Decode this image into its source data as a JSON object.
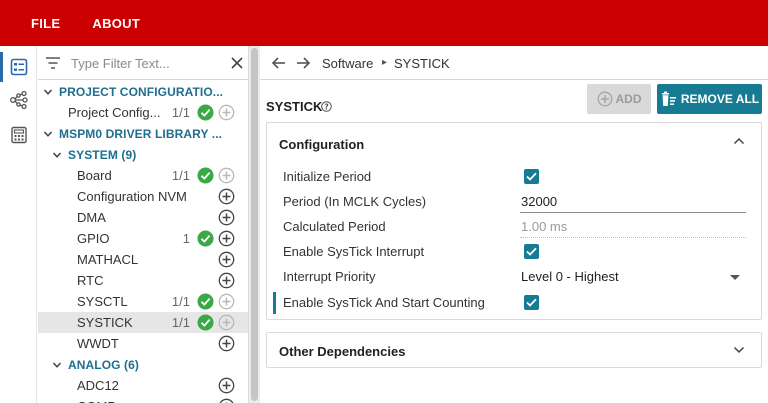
{
  "menu": {
    "file": "FILE",
    "about": "ABOUT"
  },
  "filter": {
    "placeholder": "Type Filter Text..."
  },
  "tree": [
    {
      "key": "project-configuration",
      "label": "PROJECT CONFIGURATIO...",
      "type": "section",
      "level": 0,
      "expanded": true
    },
    {
      "key": "project-config",
      "label": "Project Config...",
      "type": "item",
      "level": 1,
      "count": "1/1",
      "check": true,
      "add": "disabled"
    },
    {
      "key": "mspm0-driver-library",
      "label": "MSPM0 DRIVER LIBRARY ...",
      "type": "section",
      "level": 0,
      "expanded": true
    },
    {
      "key": "system",
      "label": "SYSTEM (9)",
      "type": "section",
      "level": 1,
      "expanded": true
    },
    {
      "key": "board",
      "label": "Board",
      "type": "item",
      "level": 2,
      "count": "1/1",
      "check": true,
      "add": "disabled"
    },
    {
      "key": "configuration-nvm",
      "label": "Configuration NVM",
      "type": "item",
      "level": 2,
      "count": "",
      "check": false,
      "add": "enabled"
    },
    {
      "key": "dma",
      "label": "DMA",
      "type": "item",
      "level": 2,
      "count": "",
      "check": false,
      "add": "enabled"
    },
    {
      "key": "gpio",
      "label": "GPIO",
      "type": "item",
      "level": 2,
      "count": "1",
      "check": true,
      "add": "enabled"
    },
    {
      "key": "mathacl",
      "label": "MATHACL",
      "type": "item",
      "level": 2,
      "count": "",
      "check": false,
      "add": "enabled"
    },
    {
      "key": "rtc",
      "label": "RTC",
      "type": "item",
      "level": 2,
      "count": "",
      "check": false,
      "add": "enabled"
    },
    {
      "key": "sysctl",
      "label": "SYSCTL",
      "type": "item",
      "level": 2,
      "count": "1/1",
      "check": true,
      "add": "disabled"
    },
    {
      "key": "systick",
      "label": "SYSTICK",
      "type": "item",
      "level": 2,
      "count": "1/1",
      "check": true,
      "add": "disabled",
      "selected": true
    },
    {
      "key": "wwdt",
      "label": "WWDT",
      "type": "item",
      "level": 2,
      "count": "",
      "check": false,
      "add": "enabled"
    },
    {
      "key": "analog",
      "label": "ANALOG (6)",
      "type": "section",
      "level": 1,
      "expanded": true
    },
    {
      "key": "adc12",
      "label": "ADC12",
      "type": "item",
      "level": 2,
      "count": "",
      "check": false,
      "add": "enabled"
    },
    {
      "key": "comp",
      "label": "COMP",
      "type": "item",
      "level": 2,
      "count": "",
      "check": false,
      "add": "enabled"
    }
  ],
  "breadcrumb": {
    "parent": "Software",
    "current": "SYSTICK"
  },
  "page": {
    "title": "SYSTICK",
    "add_label": "ADD",
    "remove_all_label": "REMOVE ALL"
  },
  "config": {
    "title": "Configuration",
    "props": {
      "initialize_period": {
        "label": "Initialize Period",
        "checked": true
      },
      "period": {
        "label": "Period (In MCLK Cycles)",
        "value": "32000"
      },
      "calculated_period": {
        "label": "Calculated Period",
        "value": "1.00 ms"
      },
      "enable_interrupt": {
        "label": "Enable SysTick Interrupt",
        "checked": true
      },
      "interrupt_priority": {
        "label": "Interrupt Priority",
        "value": "Level 0 - Highest"
      },
      "enable_start": {
        "label": "Enable SysTick And Start Counting",
        "checked": true
      }
    }
  },
  "deps": {
    "title": "Other Dependencies"
  },
  "colors": {
    "topbar": "#cc0000",
    "accent": "#177c93",
    "check_green": "#3aa845",
    "section_text": "#1e6e8e"
  }
}
